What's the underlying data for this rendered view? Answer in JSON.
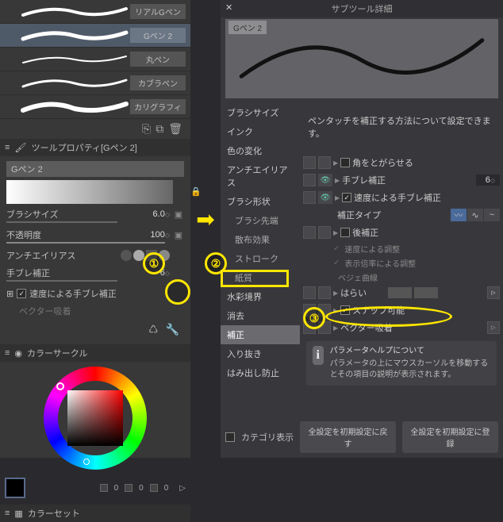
{
  "left": {
    "brushes": [
      {
        "label": "リアルGペン"
      },
      {
        "label": "Gペン 2",
        "selected": true
      },
      {
        "label": "丸ペン"
      },
      {
        "label": "カブラペン"
      },
      {
        "label": "カリグラフィ"
      }
    ],
    "tool_property_title": "ツールプロパティ[Gペン 2]",
    "prop_title": "Gペン 2",
    "brush_size_label": "ブラシサイズ",
    "brush_size_val": "6.0",
    "opacity_label": "不透明度",
    "opacity_val": "100",
    "antialias_label": "アンチエイリアス",
    "stabilize_label": "手ブレ補正",
    "stabilize_val": "6",
    "speed_stabilize_label": "速度による手ブレ補正",
    "vector_snap_label": "ベクター吸着",
    "color_circle_title": "カラーサークル",
    "hsv": {
      "h": "0",
      "s": "0",
      "v": "0"
    },
    "color_set_title": "カラーセット"
  },
  "right": {
    "title": "サブツール詳細",
    "preview_label": "Gペン 2",
    "help_text": "ペンタッチを補正する方法について設定できます。",
    "categories": [
      {
        "label": "ブラシサイズ"
      },
      {
        "label": "インク"
      },
      {
        "label": "色の変化"
      },
      {
        "label": "アンチエイリアス"
      },
      {
        "label": "ブラシ形状"
      },
      {
        "label": "ブラシ先端",
        "indent": true
      },
      {
        "label": "散布効果",
        "indent": true
      },
      {
        "label": "ストローク",
        "indent": true
      },
      {
        "label": "紙質",
        "indent": true
      },
      {
        "label": "水彩境界"
      },
      {
        "label": "消去"
      },
      {
        "label": "補正",
        "selected": true
      },
      {
        "label": "入り抜き"
      },
      {
        "label": "はみ出し防止"
      }
    ],
    "settings": {
      "sharp_corner": "角をとがらせる",
      "stabilize": "手ブレ補正",
      "stabilize_val": "6",
      "speed_stabilize": "速度による手ブレ補正",
      "stabilize_type": "補正タイプ",
      "post_correct": "後補正",
      "sub_speed": "速度による調整",
      "sub_zoom": "表示倍率による調整",
      "sub_bezier": "ベジェ曲線",
      "brush_off": "はらい",
      "snap": "スナップ可能",
      "vector_snap": "ベクター吸着"
    },
    "param_help_title": "パラメータヘルプについて",
    "param_help_body": "パラメータの上にマウスカーソルを移動するとその項目の説明が表示されます。",
    "category_show": "カテゴリ表示",
    "btn_reset": "全設定を初期設定に戻す",
    "btn_register": "全設定を初期設定に登録"
  },
  "annotations": {
    "one": "①",
    "two": "②",
    "three": "③"
  }
}
